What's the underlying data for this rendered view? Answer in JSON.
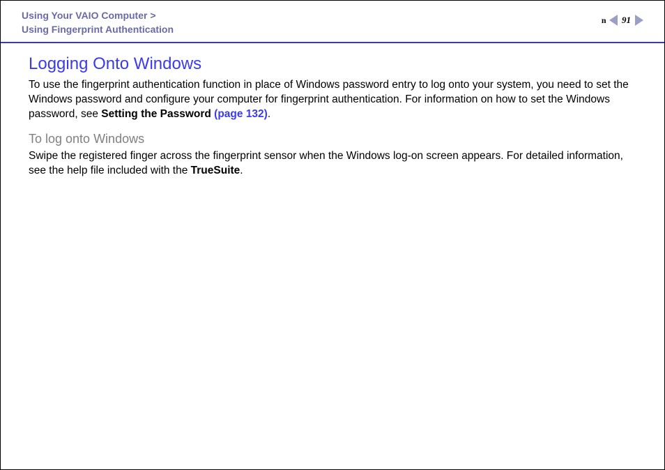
{
  "header": {
    "breadcrumb1": "Using Your VAIO Computer",
    "sep": ">",
    "breadcrumb2": "Using Fingerprint Authentication",
    "page_number": "91",
    "n_label": "n"
  },
  "content": {
    "title": "Logging Onto Windows",
    "p1_a": "To use the fingerprint authentication function in place of Windows password entry to log onto your system, you need to set the Windows password and configure your computer for fingerprint authentication. For information on how to set the Windows password, see ",
    "p1_bold": "Setting the Password ",
    "p1_link": "(page 132)",
    "p1_end": ".",
    "subheading": "To log onto Windows",
    "p2_a": "Swipe the registered finger across the fingerprint sensor when the Windows log-on screen appears. For detailed information, see the help file included with the ",
    "p2_bold": "TrueSuite",
    "p2_end": "."
  }
}
